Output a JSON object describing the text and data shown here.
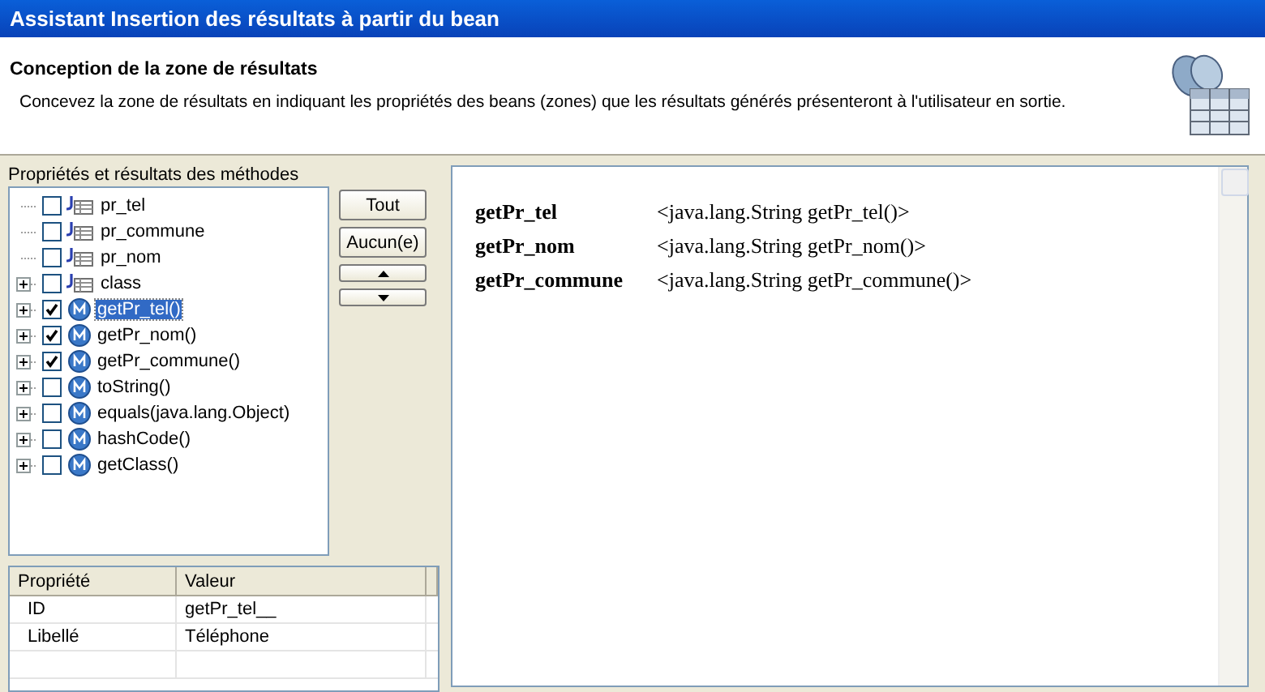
{
  "window": {
    "title": "Assistant Insertion des résultats à partir du bean"
  },
  "header": {
    "title": "Conception de la zone de résultats",
    "description": "Concevez la zone de résultats en indiquant les propriétés des beans (zones) que les résultats générés présenteront à l'utilisateur en sortie."
  },
  "tree": {
    "label": "Propriétés et résultats des méthodes",
    "items": [
      {
        "kind": "field",
        "label": "pr_tel",
        "checked": false,
        "selected": false,
        "expandable": false
      },
      {
        "kind": "field",
        "label": "pr_commune",
        "checked": false,
        "selected": false,
        "expandable": false
      },
      {
        "kind": "field",
        "label": "pr_nom",
        "checked": false,
        "selected": false,
        "expandable": false
      },
      {
        "kind": "field",
        "label": "class",
        "checked": false,
        "selected": false,
        "expandable": true
      },
      {
        "kind": "method",
        "label": "getPr_tel()",
        "checked": true,
        "selected": true,
        "expandable": true
      },
      {
        "kind": "method",
        "label": "getPr_nom()",
        "checked": true,
        "selected": false,
        "expandable": true
      },
      {
        "kind": "method",
        "label": "getPr_commune()",
        "checked": true,
        "selected": false,
        "expandable": true
      },
      {
        "kind": "method",
        "label": "toString()",
        "checked": false,
        "selected": false,
        "expandable": true
      },
      {
        "kind": "method",
        "label": "equals(java.lang.Object)",
        "checked": false,
        "selected": false,
        "expandable": true
      },
      {
        "kind": "method",
        "label": "hashCode()",
        "checked": false,
        "selected": false,
        "expandable": true
      },
      {
        "kind": "method",
        "label": "getClass()",
        "checked": false,
        "selected": false,
        "expandable": true
      }
    ]
  },
  "buttons": [
    {
      "kind": "text",
      "label": "Tout"
    },
    {
      "kind": "text",
      "label": "Aucun(e)"
    },
    {
      "kind": "up"
    },
    {
      "kind": "down"
    }
  ],
  "properties": {
    "columns": [
      "Propriété",
      "Valeur"
    ],
    "rows": [
      [
        "ID",
        "getPr_tel__"
      ],
      [
        "Libellé",
        "Téléphone"
      ]
    ]
  },
  "preview": {
    "rows": [
      {
        "name": "getPr_tel",
        "value": "<java.lang.String getPr_tel()>"
      },
      {
        "name": "getPr_nom",
        "value": "<java.lang.String getPr_nom()>"
      },
      {
        "name": "getPr_commune",
        "value": "<java.lang.String getPr_commune()>"
      }
    ]
  }
}
